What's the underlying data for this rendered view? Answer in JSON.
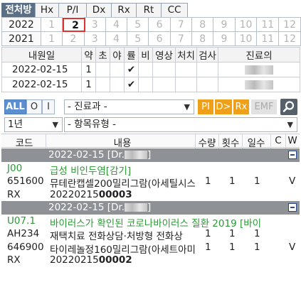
{
  "tabs": [
    "전처방",
    "Hx",
    "P/I",
    "Dx",
    "Rx",
    "Rt",
    "CC"
  ],
  "year_grid": [
    {
      "year": "2022",
      "months": [
        "1",
        "2",
        "3",
        "4",
        "5",
        "6",
        "7",
        "8",
        "9",
        "10",
        "11",
        "12"
      ],
      "selected": 1
    },
    {
      "year": "2021",
      "months": [
        "1",
        "2",
        "3",
        "4",
        "5",
        "6",
        "7",
        "8",
        "9",
        "10",
        "11",
        "12"
      ],
      "selected": -1
    }
  ],
  "visit_table": {
    "headers": [
      "내원일",
      "약",
      "초",
      "야",
      "률",
      "비",
      "영상",
      "처치",
      "검사",
      "진료의"
    ],
    "rows": [
      {
        "date": "2022-02-15",
        "yak": "1",
        "check": "✔"
      },
      {
        "date": "2022-02-15",
        "yak": "1",
        "check": "✔"
      }
    ]
  },
  "filter": {
    "segments": [
      "ALL",
      "O",
      "I"
    ],
    "dept": "- 진료과 -",
    "buttons": [
      "PI",
      "D>",
      "Rx",
      "EMF"
    ],
    "period": "1년",
    "item_type": "- 항목유형 -",
    "arrow": "▼"
  },
  "orders": {
    "headers": [
      "코드",
      "내용",
      "수량",
      "횟수",
      "일수",
      "C",
      "W"
    ],
    "rows": [
      {
        "kind": "group",
        "text": "2022-02-15 [Dr.",
        "close": "]"
      },
      {
        "kind": "dx",
        "code": "J00",
        "content": "급성 비인두염[감기]"
      },
      {
        "kind": "rx",
        "code": "651600",
        "content": "뮤테란캡셀200밀리그람(아세틸시스",
        "qty": "1",
        "times": "1",
        "days": "1",
        "w": "V"
      },
      {
        "kind": "no",
        "code": "RX",
        "prefix": "20220215",
        "num": "00003"
      },
      {
        "kind": "group",
        "text": "2022-02-15 [Dr.",
        "close": "]"
      },
      {
        "kind": "dx",
        "code": "U07.1",
        "content": "바이러스가 확인된 코로나바이러스 질환 2019 [바이"
      },
      {
        "kind": "rx",
        "code": "AH234",
        "content": "재택치료 전화상담·처방형 전화상",
        "qty": "1",
        "times": "1",
        "days": "1",
        "w": ""
      },
      {
        "kind": "rx",
        "code": "646900",
        "content": "타이레놀정160밀리그람(아세트아미",
        "qty": "1",
        "times": "1",
        "days": "1",
        "w": "V"
      },
      {
        "kind": "no",
        "code": "RX",
        "prefix": "20220215",
        "num": "00002"
      }
    ]
  }
}
